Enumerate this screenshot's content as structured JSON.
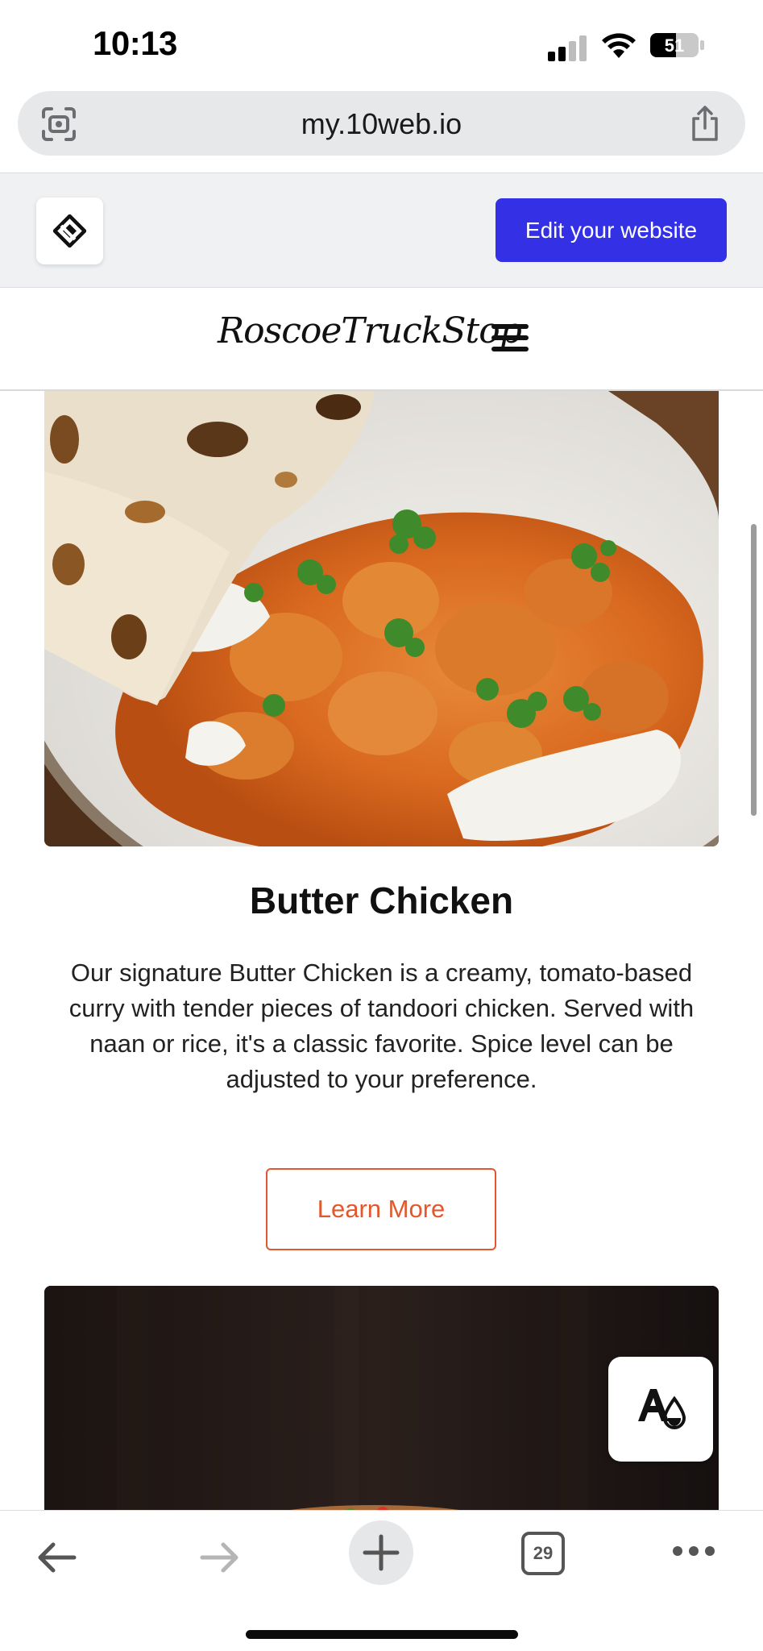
{
  "status_bar": {
    "time": "10:13",
    "battery_level": "51",
    "signal_bars": 2
  },
  "browser": {
    "url": "my.10web.io",
    "tab_count": "29"
  },
  "editor": {
    "edit_button_label": "Edit your website"
  },
  "site": {
    "title": "RoscoeTruckStop"
  },
  "dish": {
    "title": "Butter Chicken",
    "description": "Our signature Butter Chicken is a creamy, tomato-based curry with tender pieces of tandoori chicken. Served with naan or rice, it's a classic favorite. Spice level can be adjusted to your preference.",
    "cta_label": "Learn More"
  },
  "icons": {
    "url_left": "screen-scan-icon",
    "url_right": "share-icon",
    "editor_logo": "10web-logo-icon",
    "accessibility": "accessibility-contrast-icon",
    "nav": [
      "back-arrow-icon",
      "forward-arrow-icon",
      "new-tab-plus-icon",
      "tabs-count-icon",
      "more-dots-icon"
    ]
  },
  "colors": {
    "edit_button": "#3330e6",
    "cta_border": "#e2572b",
    "url_pill": "#e6e8ea",
    "editor_bar": "#f0f1f3"
  }
}
